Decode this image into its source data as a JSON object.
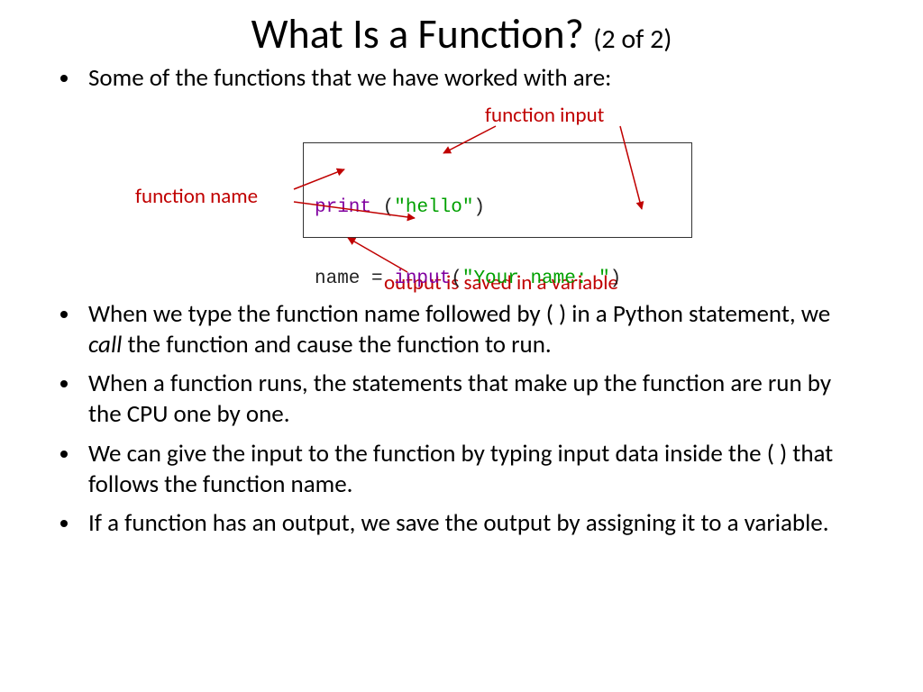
{
  "title_main": "What Is a Function?",
  "title_sub": "(2 of 2)",
  "bullets_top": [
    "Some of the functions that we have worked with are:"
  ],
  "annotations": {
    "function_input": "function input",
    "function_name": "function name",
    "output_saved": "output is saved in a variable"
  },
  "code": {
    "line1": {
      "fn": "print",
      "paren_space": " (",
      "arg": "\"hello\"",
      "close": ")"
    },
    "line2": {
      "assign": "name = ",
      "fn": "input",
      "paren": "(",
      "arg": "\"Your name: \"",
      "close": ")"
    }
  },
  "bullets_bottom": [
    {
      "pre": "When we type the function name followed by ( ) in a Python statement, we ",
      "em": "call",
      "post": " the function and cause the function to run."
    },
    {
      "text": "When a function runs, the statements that make up the function are run by the CPU one by one."
    },
    {
      "text": "We can give the input to the function by typing input data inside the ( ) that follows the function name."
    },
    {
      "text": "If a function has an output, we save the output by assigning it to a variable."
    }
  ]
}
